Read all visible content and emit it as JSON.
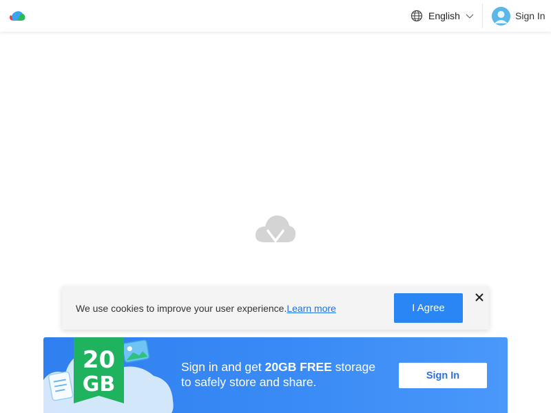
{
  "header": {
    "logo": "logo-icon",
    "language": {
      "icon": "globe-icon",
      "label": "English",
      "chevron": "chevron-down-icon"
    },
    "sign_in": {
      "avatar": "avatar-icon",
      "label": "Sign In"
    }
  },
  "main": {
    "loader_icon": "cloud-icon"
  },
  "cookie_banner": {
    "message": "We use cookies to improve your user experience.",
    "link_text": "Learn more",
    "agree_label": "I Agree",
    "close_icon": "close-icon"
  },
  "promo": {
    "badge_top": "20",
    "badge_bottom": "GB",
    "text_prefix": "Sign in and get ",
    "text_bold": "20GB FREE",
    "text_suffix": " storage to safely store and share.",
    "button_label": "Sign In"
  },
  "colors": {
    "accent": "#2b86f5",
    "link": "#1a73e8",
    "badge_green": "#1fb35f",
    "banner_blue": "#2f7ff0"
  }
}
